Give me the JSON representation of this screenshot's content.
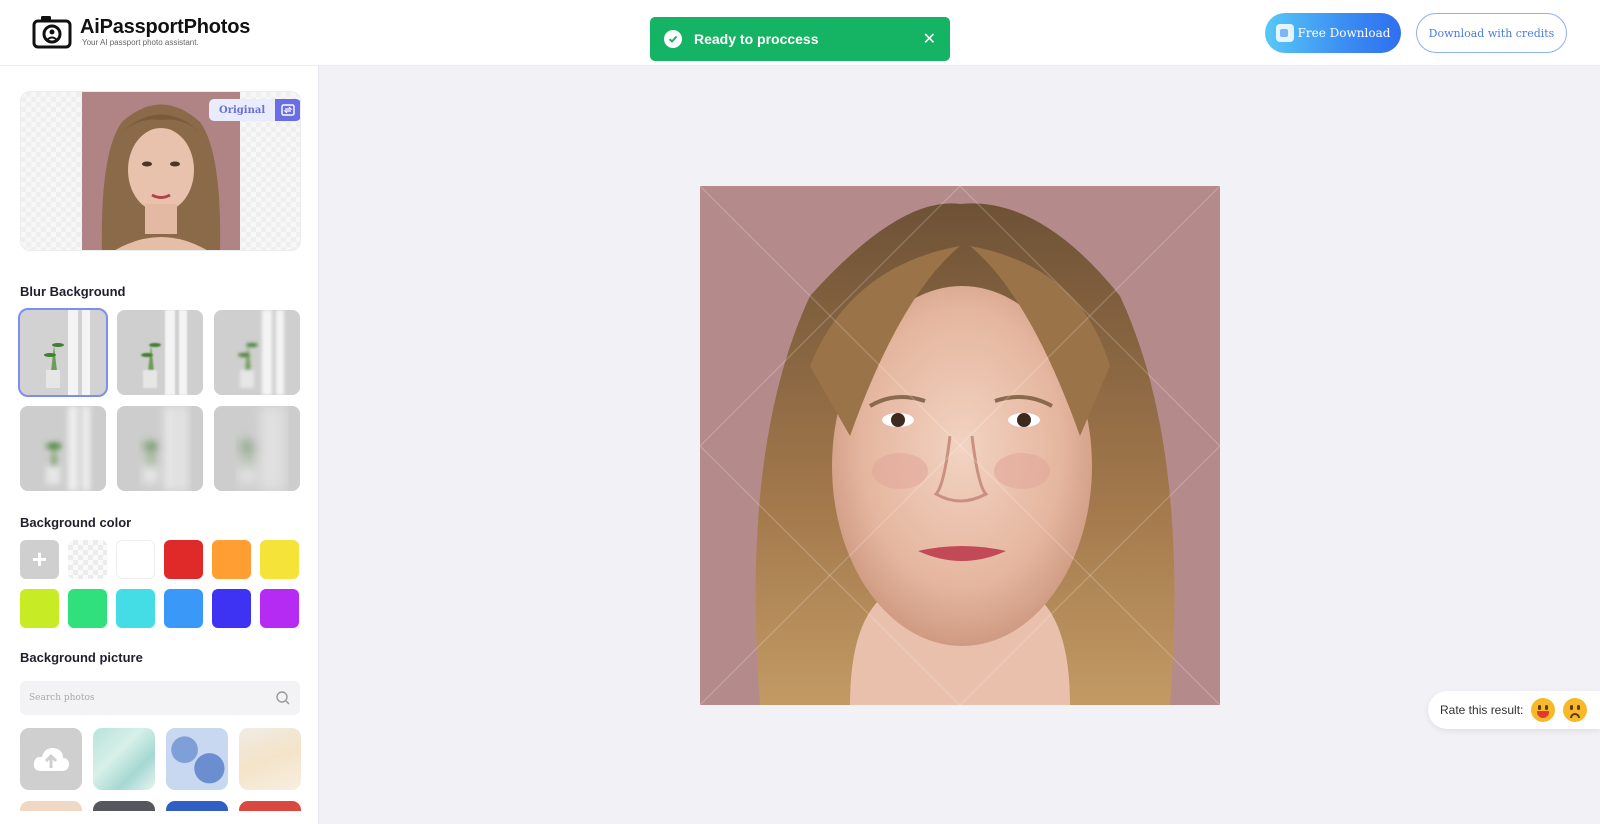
{
  "header": {
    "brand_title": "AiPassportPhotos",
    "brand_subtitle": "Your AI passport photo assistant.",
    "free_download_label": "Free Download",
    "download_credits_label": "Download with credits"
  },
  "toast": {
    "message": "Ready to proccess",
    "close_glyph": "✕",
    "color": "#15b364"
  },
  "sidebar": {
    "original_label": "Original",
    "blur_title": "Blur Background",
    "blur_options_count_selected_index": 0,
    "color_title": "Background color",
    "colors": [
      "#e02929",
      "#ff9e33",
      "#f6e33a",
      "#c7ec25",
      "#2fe07c",
      "#44dde6",
      "#3a99f8",
      "#3f33f3",
      "#b62bf3"
    ],
    "add_glyph": "+",
    "picture_title": "Background picture",
    "search_placeholder": "Search photos"
  },
  "rate": {
    "label": "Rate this result:"
  },
  "icons": [
    "camera-logo-icon",
    "check-icon",
    "close-icon",
    "ai-badge-icon",
    "swap-icon",
    "search-icon",
    "cloud-upload-icon",
    "happy-emoji-icon",
    "sad-emoji-icon"
  ]
}
